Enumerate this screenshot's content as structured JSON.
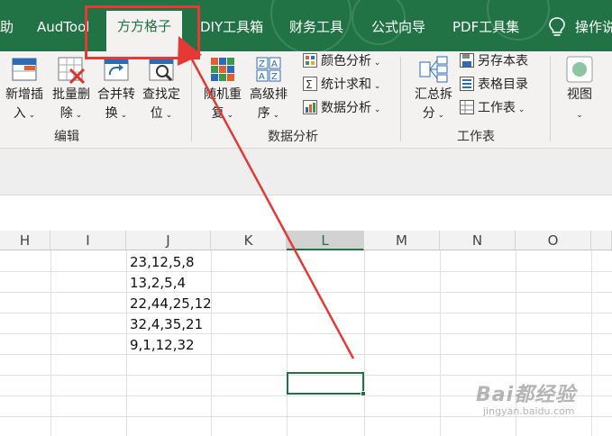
{
  "tabs": [
    {
      "label": "助"
    },
    {
      "label": "AudTool"
    },
    {
      "label": "方方格子",
      "active": true
    },
    {
      "label": "DIY工具箱"
    },
    {
      "label": "财务工具"
    },
    {
      "label": "公式向导"
    },
    {
      "label": "PDF工具集"
    },
    {
      "label": "操作说"
    }
  ],
  "tell_me_icon": "lightbulb-icon",
  "ribbon": {
    "edit_group": {
      "label": "编辑",
      "buttons": [
        {
          "line1": "新增插",
          "line2": "入",
          "icon": "insert-icon"
        },
        {
          "line1": "批量删",
          "line2": "除",
          "icon": "delete-icon"
        },
        {
          "line1": "合并转",
          "line2": "换",
          "icon": "merge-convert-icon"
        },
        {
          "line1": "查找定",
          "line2": "位",
          "icon": "find-icon"
        }
      ]
    },
    "data_group": {
      "label": "数据分析",
      "buttons": [
        {
          "line1": "随机重",
          "line2": "复",
          "icon": "random-icon"
        },
        {
          "line1": "高级排",
          "line2": "序",
          "icon": "sort-az-icon"
        }
      ],
      "small_buttons": [
        {
          "label": "颜色分析",
          "icon": "color-analysis-icon"
        },
        {
          "label": "统计求和",
          "icon": "sum-icon"
        },
        {
          "label": "数据分析",
          "icon": "data-analysis-icon"
        }
      ]
    },
    "sheet_group": {
      "label": "工作表",
      "buttons": [
        {
          "line1": "汇总拆",
          "line2": "分",
          "icon": "summary-split-icon"
        }
      ],
      "small_buttons": [
        {
          "label": "另存本表",
          "icon": "save-sheet-icon"
        },
        {
          "label": "表格目录",
          "icon": "sheet-index-icon"
        },
        {
          "label": "工作表",
          "icon": "worksheet-icon"
        }
      ]
    },
    "view_group": {
      "buttons": [
        {
          "line1": "视图",
          "icon": "view-icon"
        }
      ]
    }
  },
  "columns": [
    "H",
    "I",
    "J",
    "K",
    "L",
    "M",
    "N",
    "O"
  ],
  "selected_column": "L",
  "cells": [
    "23,12,5,8",
    "13,2,5,4",
    "22,44,25,12",
    "32,4,35,21",
    "9,1,12,32"
  ],
  "watermark": {
    "main": "Bai都经验",
    "sub": "jingyan.baidu.com"
  },
  "colors": {
    "brand": "#217346",
    "annotation": "#e53935"
  }
}
